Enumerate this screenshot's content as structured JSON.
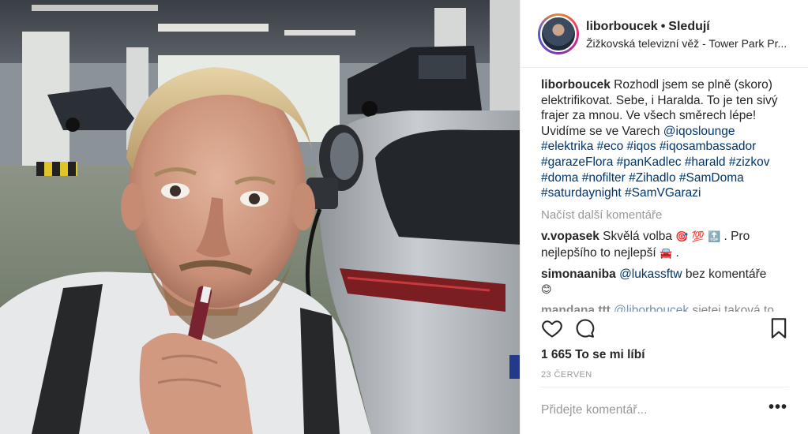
{
  "post": {
    "username": "liborboucek",
    "separator": "•",
    "follow_label": "Sledují",
    "location": "Žižkovská televizní věž - Tower Park Pr...",
    "caption": {
      "username": "liborboucek",
      "text": "Rozhodl jsem se plně (skoro) elektrifikovat. Sebe, i Haralda. To je ten sivý frajer za mnou. Ve všech směrech lépe! Uvidíme se ve Varech ",
      "mention": "@iqoslounge",
      "hashtags": "#elektrika #eco #iqos #iqosambassador #garazeFlora #panKadlec #harald #zizkov #doma #nofilter #Zihadlo #SamDoma #saturdaynight #SamVGarazi"
    },
    "load_more": "Načíst další komentáře",
    "comments": [
      {
        "user": "v.vopasek",
        "text": "Skvělá volba",
        "emojis": "🎯 💯 🔝",
        "text2": ". Pro nejlepšího to nejlepší",
        "emoji2": "🚘",
        "text3": "."
      },
      {
        "user": "simonaaniba",
        "mention": "@lukassftw",
        "text": "bez komentáře",
        "emojis": "😊"
      },
      {
        "user": "mandana.ttt",
        "mention": "@liborboucek",
        "text": "sjetej taková to"
      }
    ],
    "actions": {
      "like_icon": "heart-icon",
      "comment_icon": "comment-bubble-icon",
      "save_icon": "bookmark-icon"
    },
    "likes": "1 665 To se mi líbí",
    "date": "23 ČERVEN",
    "comment_placeholder": "Přidejte komentář...",
    "options": "•••"
  }
}
